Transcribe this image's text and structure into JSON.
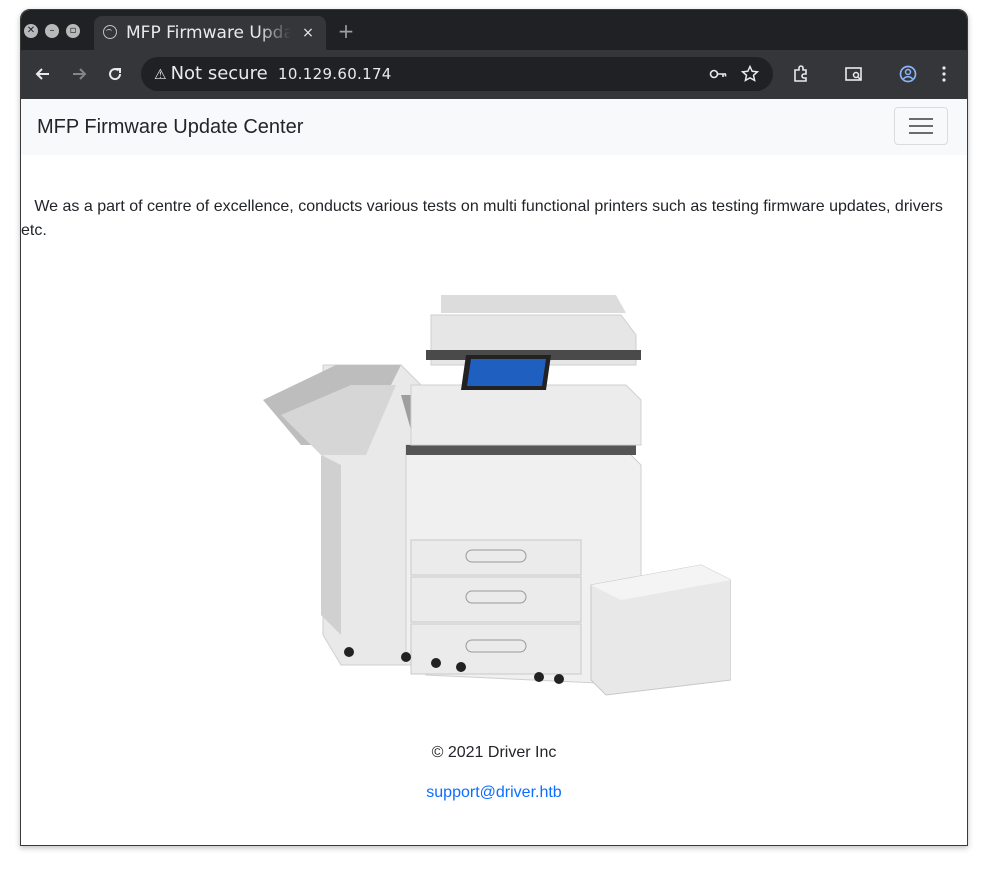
{
  "browser": {
    "tab_title": "MFP Firmware Update Center",
    "tab_close_glyph": "×",
    "new_tab_glyph": "+",
    "security_label": "Not secure",
    "url": "10.129.60.174",
    "icons": [
      "close-window-icon",
      "minimize-window-icon",
      "maximize-window-icon",
      "globe-icon",
      "back-arrow-icon",
      "forward-arrow-icon",
      "reload-icon",
      "warning-icon",
      "key-icon",
      "star-icon",
      "extensions-icon",
      "search-tabs-icon",
      "profile-icon",
      "menu-kebab-icon"
    ]
  },
  "navbar": {
    "brand": "MFP Firmware Update Center"
  },
  "content": {
    "intro": "We as a part of centre of excellence, conducts various tests on multi functional printers such as testing firmware updates, drivers etc."
  },
  "footer": {
    "copyright": "© 2021 Driver Inc",
    "email": "support@driver.htb"
  },
  "colors": {
    "link": "#0d6efd",
    "navbar_bg": "#f8f9fa",
    "chrome_dark": "#202124",
    "chrome_toolbar": "#35363a"
  }
}
